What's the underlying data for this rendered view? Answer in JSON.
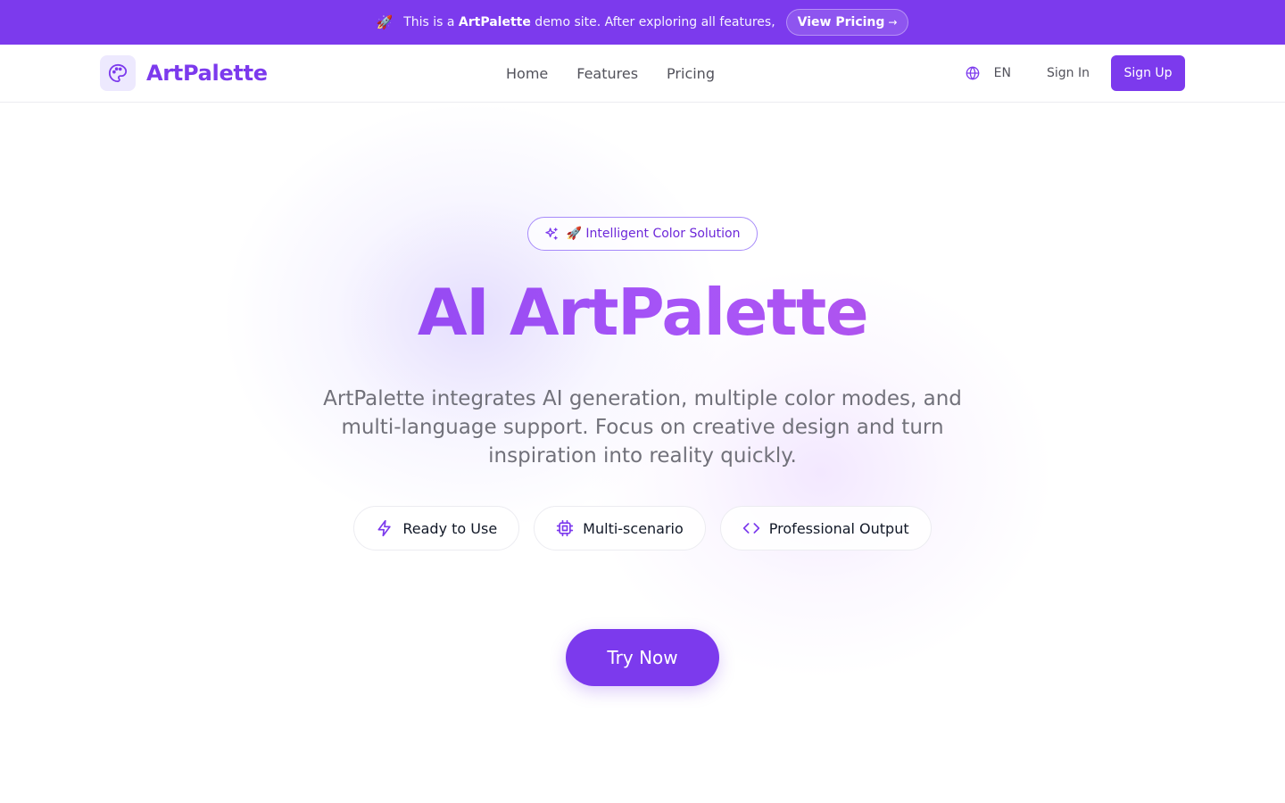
{
  "banner": {
    "icon": "rocket-icon",
    "text_before": "This is a ",
    "brand": "ArtPalette",
    "text_after": " demo site. After exploring all features,",
    "button_label": "View Pricing",
    "button_arrow": "→"
  },
  "header": {
    "logo_icon": "palette-icon",
    "logo_text": "ArtPalette",
    "nav": [
      "Home",
      "Features",
      "Pricing"
    ],
    "language": "EN",
    "sign_in": "Sign In",
    "sign_up": "Sign Up"
  },
  "hero": {
    "badge": "🚀 Intelligent Color Solution",
    "title": "AI ArtPalette",
    "subtitle": "ArtPalette integrates AI generation, multiple color modes, and multi-language support. Focus on creative design and turn inspiration into reality quickly.",
    "features": [
      {
        "label": "Ready to Use",
        "icon": "lightning-icon"
      },
      {
        "label": "Multi-scenario",
        "icon": "chip-icon"
      },
      {
        "label": "Professional Output",
        "icon": "code-icon"
      }
    ],
    "cta": "Try Now"
  },
  "colors": {
    "accent": "#7c3aed",
    "gradient_end": "#c04fd9"
  }
}
